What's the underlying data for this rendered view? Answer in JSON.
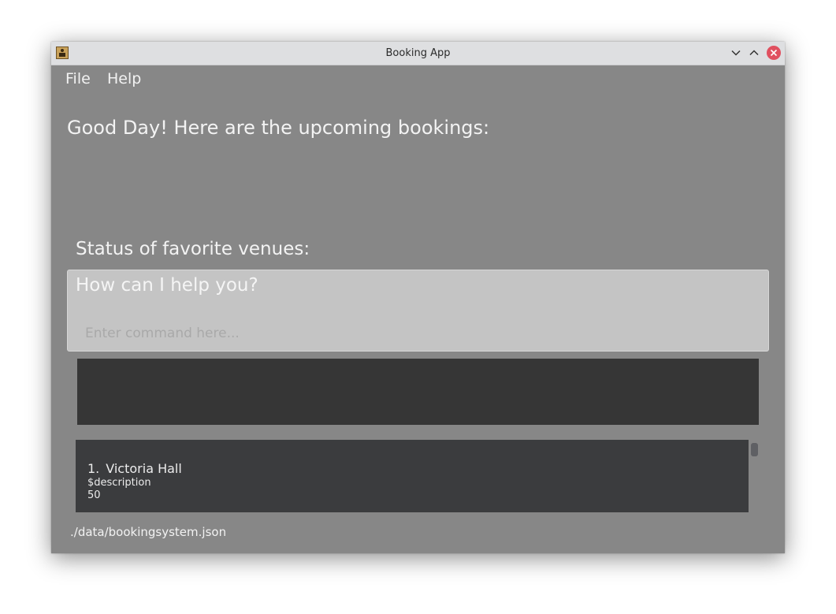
{
  "window": {
    "title": "Booking App"
  },
  "menu": {
    "file": "File",
    "help": "Help"
  },
  "main": {
    "greeting": "Good Day! Here are the upcoming bookings:",
    "favorites_label": "Status of favorite venues:"
  },
  "command": {
    "prompt": "How can I help you?",
    "placeholder": "Enter command here...",
    "value": ""
  },
  "result": {
    "text": ""
  },
  "venues": [
    {
      "index": "1.",
      "name": "Victoria Hall",
      "description": "$description",
      "capacity": "50"
    }
  ],
  "status": {
    "path": "./data/bookingsystem.json"
  },
  "icons": {
    "app": "app-icon",
    "minimize": "chevron-down-icon",
    "maximize": "chevron-up-icon",
    "close": "close-icon"
  },
  "colors": {
    "background": "#878787",
    "command_box": "#c4c4c4",
    "result_box": "#363636",
    "list_panel": "#3b3c3e",
    "close_button": "#e0505f"
  }
}
